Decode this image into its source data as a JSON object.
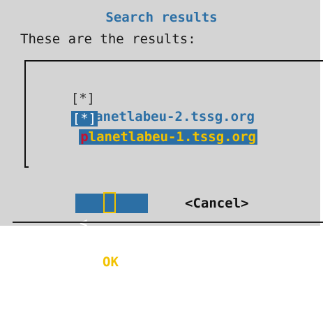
{
  "dialog": {
    "title": "Search results",
    "prompt": "These are the results:"
  },
  "results": [
    {
      "checkbox": "[*]",
      "first_char": "p",
      "rest": "lanetlabeu-2.tssg.org",
      "selected": false
    },
    {
      "checkbox": "[*]",
      "first_char": "p",
      "rest": "lanetlabeu-1.tssg.org",
      "selected": true
    }
  ],
  "buttons": {
    "ok_left": "<",
    "ok_label": "OK",
    "ok_right": ">",
    "cancel_label": "<Cancel>"
  },
  "colors": {
    "dialog_bg": "#d4d4d4",
    "title": "#2c6fa5",
    "selection_bg": "#2c6fa5",
    "hotkey": "#c8102e",
    "selected_text": "#f2c200"
  }
}
